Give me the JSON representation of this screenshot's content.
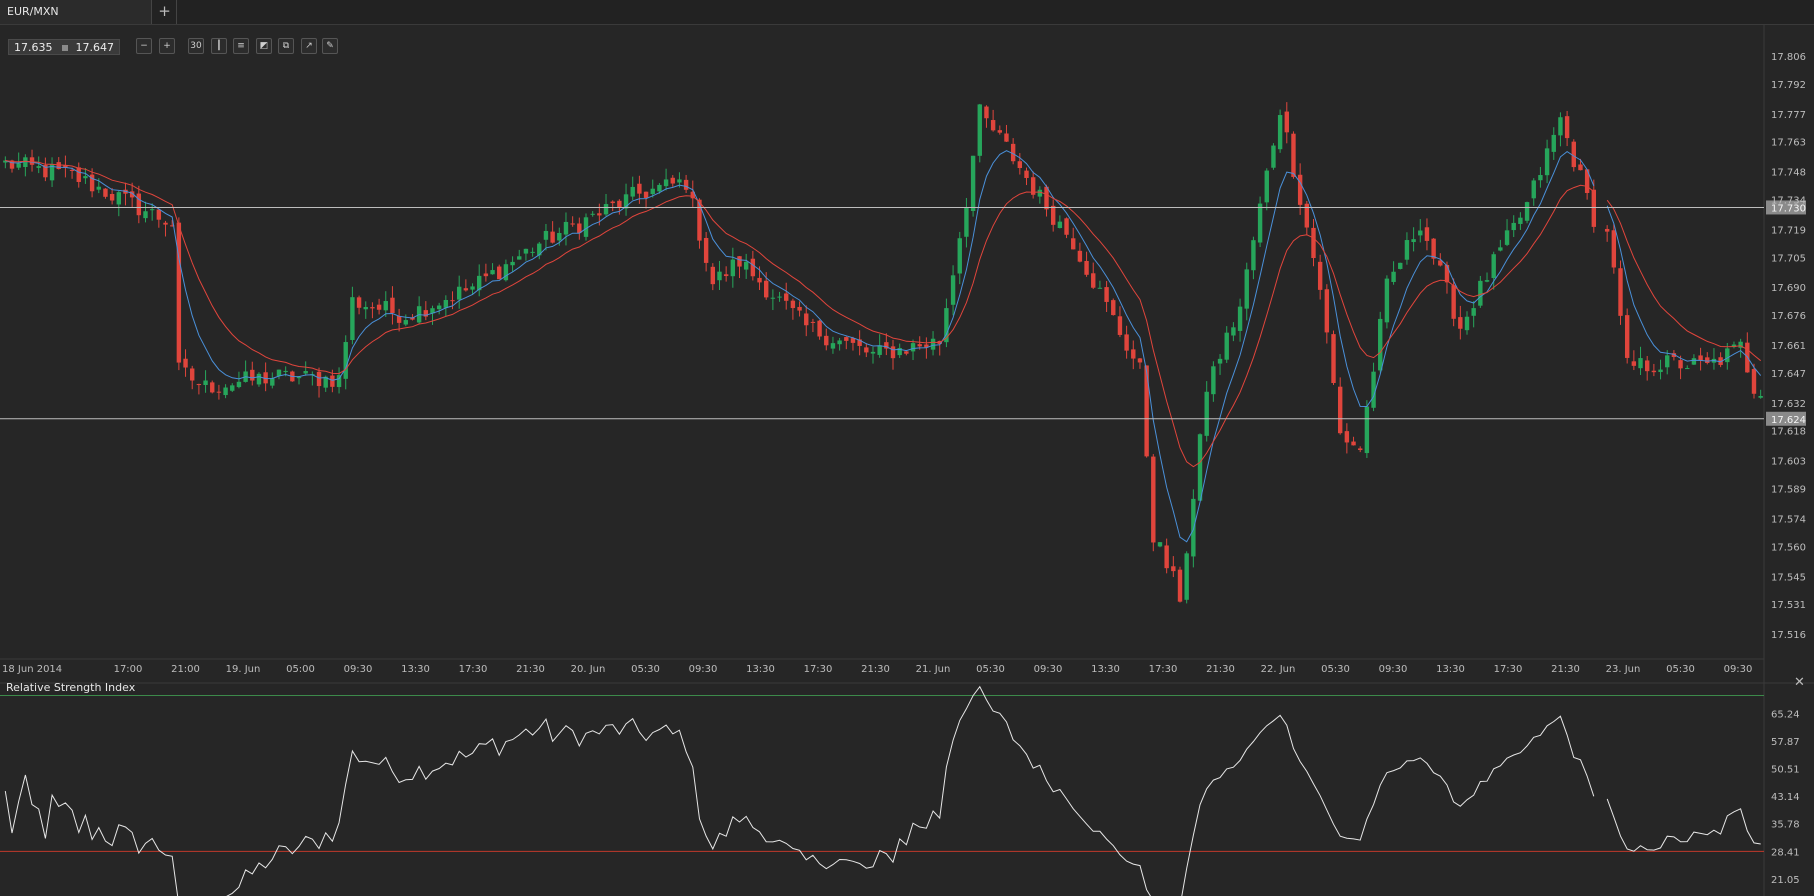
{
  "header": {
    "tab_label": "EUR/MXN",
    "add_tab_label": "+"
  },
  "quote": {
    "bid": "17.635",
    "ask": "17.647"
  },
  "toolbar": [
    {
      "name": "zoom-out-icon",
      "glyph": "−"
    },
    {
      "name": "zoom-in-icon",
      "glyph": "+"
    },
    {
      "name": "timeframe-button",
      "glyph": "30"
    },
    {
      "name": "chart-type-icon",
      "glyph": "┃"
    },
    {
      "name": "indicators-icon",
      "glyph": "≡"
    },
    {
      "name": "draw-tools-icon",
      "glyph": "◩"
    },
    {
      "name": "objects-icon",
      "glyph": "⧉"
    },
    {
      "name": "settings-icon",
      "glyph": "↗"
    },
    {
      "name": "pencil-icon",
      "glyph": "✎"
    }
  ],
  "colors": {
    "background": "#262626",
    "bull": "#26a65b",
    "bear": "#e0453c",
    "ma_fast": "#4a90d9",
    "ma_slow": "#e0453c",
    "rsi_line": "#e6e6e6"
  },
  "chart_data": [
    {
      "type": "candlestick",
      "ylim": [
        17.505,
        17.814
      ],
      "y_ticks": [
        "17.806",
        "17.792",
        "17.777",
        "17.763",
        "17.748",
        "17.734",
        "17.719",
        "17.705",
        "17.690",
        "17.676",
        "17.661",
        "17.647",
        "17.632",
        "17.618",
        "17.603",
        "17.589",
        "17.574",
        "17.560",
        "17.545",
        "17.531",
        "17.516"
      ],
      "x_ticks": [
        "18 Jun 2014",
        "17:00",
        "21:00",
        "19. Jun",
        "05:00",
        "09:30",
        "13:30",
        "17:30",
        "21:30",
        "20. Jun",
        "05:30",
        "09:30",
        "13:30",
        "17:30",
        "21:30",
        "21. Jun",
        "05:30",
        "09:30",
        "13:30",
        "17:30",
        "21:30",
        "22. Jun",
        "05:30",
        "09:30",
        "13:30",
        "17:30",
        "21:30",
        "23. Jun",
        "05:30",
        "09:30"
      ],
      "horizontal_lines": [
        {
          "value": 17.73,
          "label": "17.730"
        },
        {
          "value": 17.624,
          "label": "17.624"
        }
      ],
      "close_anchors": [
        [
          0,
          17.752
        ],
        [
          10,
          17.746
        ],
        [
          20,
          17.73
        ],
        [
          25,
          17.722
        ],
        [
          26,
          17.648
        ],
        [
          30,
          17.64
        ],
        [
          40,
          17.645
        ],
        [
          50,
          17.644
        ],
        [
          52,
          17.683
        ],
        [
          60,
          17.676
        ],
        [
          70,
          17.69
        ],
        [
          80,
          17.712
        ],
        [
          95,
          17.737
        ],
        [
          102,
          17.743
        ],
        [
          106,
          17.692
        ],
        [
          110,
          17.703
        ],
        [
          120,
          17.67
        ],
        [
          130,
          17.656
        ],
        [
          140,
          17.663
        ],
        [
          144,
          17.734
        ],
        [
          146,
          17.777
        ],
        [
          150,
          17.76
        ],
        [
          155,
          17.735
        ],
        [
          160,
          17.713
        ],
        [
          170,
          17.648
        ],
        [
          172,
          17.566
        ],
        [
          176,
          17.535
        ],
        [
          178,
          17.583
        ],
        [
          180,
          17.64
        ],
        [
          185,
          17.68
        ],
        [
          191,
          17.78
        ],
        [
          197,
          17.69
        ],
        [
          200,
          17.616
        ],
        [
          203,
          17.609
        ],
        [
          207,
          17.69
        ],
        [
          212,
          17.723
        ],
        [
          218,
          17.67
        ],
        [
          223,
          17.702
        ],
        [
          228,
          17.731
        ],
        [
          233,
          17.774
        ],
        [
          238,
          17.725
        ],
        [
          240,
          17.72
        ],
        [
          243,
          17.65
        ],
        [
          250,
          17.652
        ],
        [
          255,
          17.65
        ],
        [
          260,
          17.66
        ],
        [
          262,
          17.64
        ]
      ],
      "gaps": [
        [
          238,
          240
        ]
      ],
      "ma_fast_period": 6,
      "ma_slow_period": 14
    },
    {
      "type": "line",
      "title": "Relative Strength Index",
      "ylim": [
        16.5,
        72.0
      ],
      "y_ticks": [
        "65.24",
        "57.87",
        "50.51",
        "43.14",
        "35.78",
        "28.41",
        "21.05"
      ],
      "levels": [
        28.41,
        70.0
      ],
      "values_source": "rsi_from_closes"
    }
  ]
}
